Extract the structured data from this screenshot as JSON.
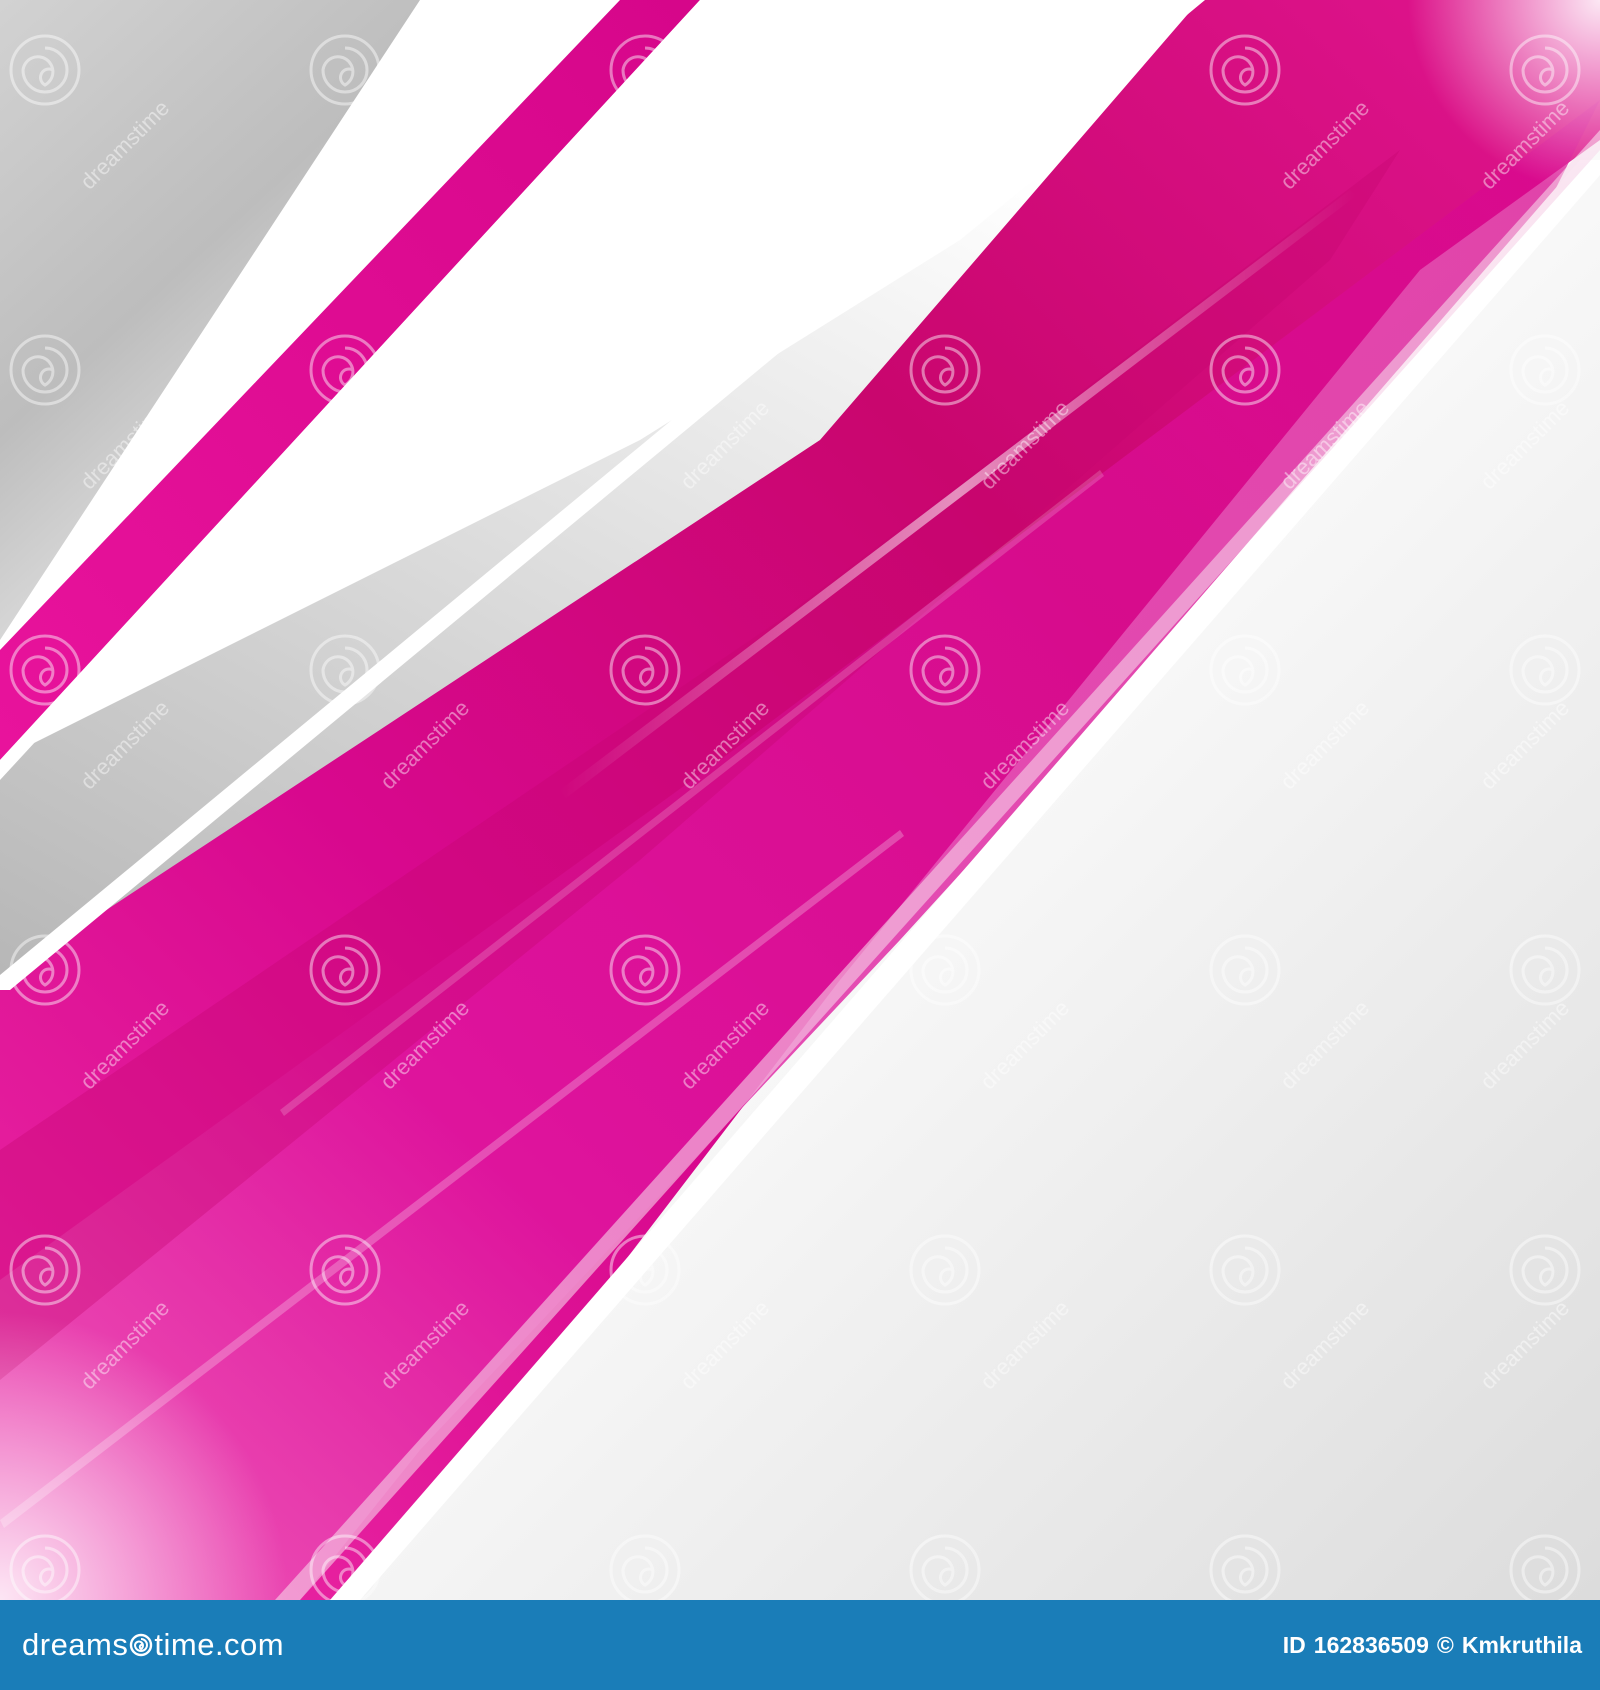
{
  "colors": {
    "magenta_dark": "#c8006e",
    "magenta_main": "#e0119a",
    "magenta_light": "#ef4fb6",
    "grey_shadow": "#a8a8a8",
    "background_light": "#f4f4f4",
    "footer_background": "#1a7db8"
  },
  "watermark": {
    "icon": "spiral-icon",
    "text": "dreamstime"
  },
  "footer": {
    "logo_text_before": "dreams",
    "logo_text_after": "time.com",
    "image_id_label": "ID",
    "image_id": "162836509",
    "copyright_symbol": "©",
    "author": "Kmkruthila"
  }
}
